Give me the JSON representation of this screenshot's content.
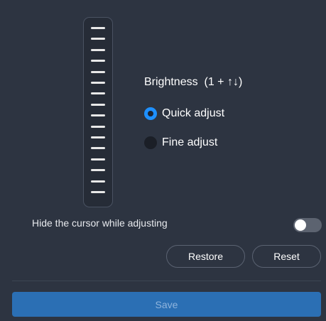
{
  "slider": {
    "tick_count": 16
  },
  "brightness": {
    "label": "Brightness",
    "shortcut": "(1 + ↑↓)"
  },
  "modes": [
    {
      "label": "Quick adjust",
      "selected": true
    },
    {
      "label": "Fine adjust",
      "selected": false
    }
  ],
  "hide_cursor": {
    "label": "Hide the cursor while adjusting",
    "enabled": false
  },
  "buttons": {
    "restore": "Restore",
    "reset": "Reset",
    "save": "Save"
  },
  "colors": {
    "background": "#2d3441",
    "accent": "#1e90ff",
    "save_button": "#2b6fb4",
    "save_text": "#8fb4dd"
  }
}
